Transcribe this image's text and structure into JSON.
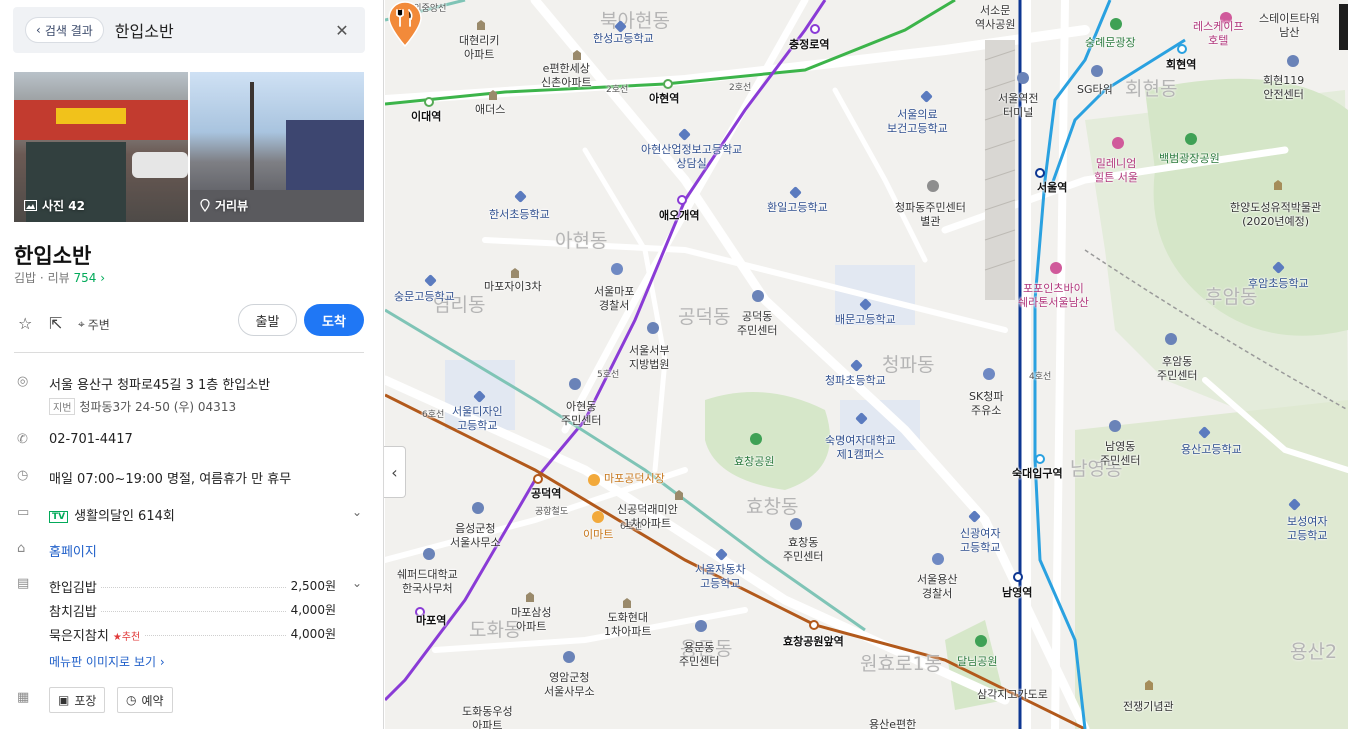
{
  "search": {
    "back_label": "검색 결과",
    "query": "한입소반"
  },
  "photos": {
    "count_label": "사진 42",
    "streetview_label": "거리뷰"
  },
  "place": {
    "name": "한입소반",
    "category": "김밥",
    "review_label": "리뷰",
    "review_count": "754",
    "nearby_label": "주변",
    "start_label": "출발",
    "arrive_label": "도착",
    "address": "서울 용산구 청파로45길 3 1층 한입소반",
    "jibun_tag": "지번",
    "jibun_address": "청파동3가 24-50 (우) 04313",
    "phone": "02-701-4417",
    "hours": "매일 07:00~19:00 명절, 여름휴가 만 휴무",
    "tv_tag": "TV",
    "tv": "생활의달인 614회",
    "homepage": "홈페이지",
    "menu": [
      {
        "name": "한입김밥",
        "price": "2,500원",
        "recommend": ""
      },
      {
        "name": "참치김밥",
        "price": "4,000원",
        "recommend": ""
      },
      {
        "name": "묵은지참치",
        "price": "4,000원",
        "recommend": "추천"
      }
    ],
    "menu_more": "메뉴판 이미지로 보기",
    "services": [
      "포장",
      "예약"
    ]
  },
  "map": {
    "labels": {
      "dong_buk": "북아현동",
      "dong_ahyeon": "아현동",
      "dong_gongdeok": "공덕동",
      "dong_yeomni": "염리동",
      "dong_cheongpa": "청파동",
      "dong_hyochang": "효창동",
      "dong_dohwa": "도화동",
      "dong_yongmun": "용문동",
      "dong_wonhyoro": "원효로1동",
      "dong_huam": "후암동",
      "dong_namyeong": "남영동",
      "dong_hoehyeon": "회현동",
      "dong_yongsan2": "용산2"
    },
    "stations": {
      "ewha": "이대역",
      "ahyeon": "아현역",
      "chungjeongno": "충정로역",
      "aeogae": "애오개역",
      "gongdeok": "공덕역",
      "mapo": "마포역",
      "hyochang": "효창공원앞역",
      "seoul": "서울역",
      "sookmyung": "숙대입구역",
      "namyeong": "남영역",
      "hoehyeon": "회현역"
    },
    "pois": {
      "hansung": "한성고등학교",
      "daehyeon": "대현리키\n아파트",
      "epyeon": "e편한세상\n신촌아파트",
      "aedeoseu": "애더스",
      "ahyeon_high": "아현산업정보고등학교\n상담실",
      "hanseo": "한서초등학교",
      "mapo_xi": "마포자이3차",
      "soongmun": "숭문고등학교",
      "mapo_police": "서울마포\n경찰서",
      "west_court": "서울서부\n지방법원",
      "gongdeok_center": "공덕동\n주민센터",
      "design_high": "서울디자인\n고등학교",
      "ahyeon_center": "아현동\n주민센터",
      "mapo_market": "마포공덕시장",
      "raemian": "신공덕래미안\n1차아파트",
      "emart": "이마트",
      "eungseong": "음성군청\n서울사무소",
      "shepherd": "쉐퍼드대학교\n한국사무처",
      "mapo_samsung": "마포삼성\n아파트",
      "dohwa_hyundai": "도화현대\n1차아파트",
      "auto_high": "서울자동차\n고등학교",
      "yongmun_center": "용문동\n주민센터",
      "yeongam": "영암군청\n서울사무소",
      "dohwa_woosung": "도화동우성\n아파트",
      "hyochang_park": "효창공원",
      "hyochang_center": "효창동\n주민센터",
      "sookmyung_univ": "숙명여자대학교\n제1캠퍼스",
      "cheongpa_elem": "청파초등학교",
      "baemun": "배문고등학교",
      "hwanil": "환일고등학교",
      "cheongpa_center": "청파동주민센터\n별관",
      "medical_high": "서울의료\n보건고등학교",
      "sk": "SK청파\n주유소",
      "sinkwang": "신광여자\n고등학교",
      "yongsan_police": "서울용산\n경찰서",
      "dalnim": "달님공원",
      "samgakji": "삼각지고가도로",
      "seosomun": "서소문\n역사공원",
      "jungnim": "중림로",
      "sungnyemun": "숭례문광장",
      "seoul_terminal": "서울역전\n터미널",
      "sg": "SG타워",
      "millennium": "밀레니엄\n힐튼 서울",
      "baekbeom": "백범광장공원",
      "fairfield": "포포인츠바이\n쉐라톤서울남산",
      "hanyang_museum": "한양도성유적박물관\n(2020년예정)",
      "huam_elem": "후암초등학교",
      "huam_center": "후암동\n주민센터",
      "yongsan_high": "용산고등학교",
      "namyeong_center": "남영동\n주민센터",
      "boseong": "보성여자\n고등학교",
      "war_memorial": "전쟁기념관",
      "hoehyeon119": "회현119\n안전센터",
      "stayhotel": "스테이트타워\n남산",
      "lescape": "레스케이프\n호텔",
      "yongsan_yepyeon": "용산e편한"
    },
    "lines": {
      "line2": "2호선",
      "line5": "5호선",
      "line6": "6호선",
      "line4": "4호선",
      "line1": "1호선",
      "gyeongui": "경의중앙선",
      "airport": "공항철도"
    }
  },
  "colors": {
    "accent": "#1f77f5",
    "green": "#03aa5a",
    "line2": "#3cb44a",
    "line5": "#8a3bd6",
    "line6": "#b2591b",
    "line4": "#2aa1e0",
    "line1": "#0d3692",
    "marker": "#f28a3a"
  }
}
